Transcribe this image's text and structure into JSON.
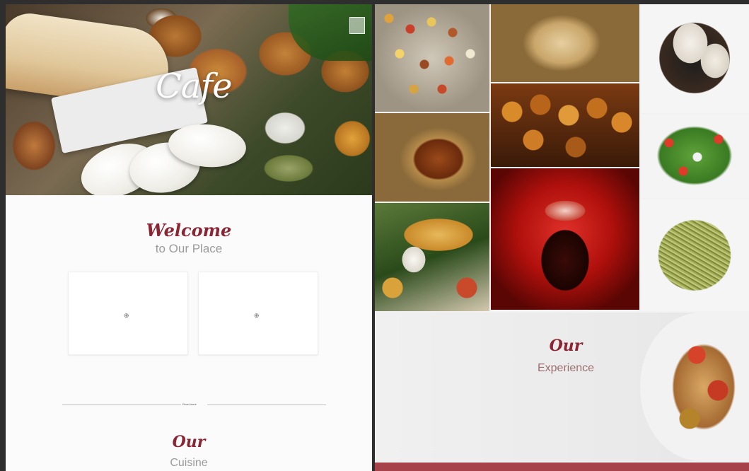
{
  "left_page": {
    "hero": {
      "logo_text": "Cafe",
      "control_icon": "square-icon"
    },
    "welcome": {
      "script": "Welcome",
      "subtitle": "to Our Place"
    },
    "cards": [
      {
        "icon": "image-placeholder-icon",
        "icon_glyph": "⊕"
      },
      {
        "icon": "image-placeholder-icon",
        "icon_glyph": "⊕"
      }
    ],
    "read_more": "Read more",
    "cuisine": {
      "script": "Our",
      "subtitle": "Cuisine"
    }
  },
  "right_page": {
    "gallery_tiles": [
      "spice-platter",
      "paratha-thali",
      "idli-plate",
      "fried-pakora",
      "chicken-bowl",
      "fresh-salad",
      "cola-splash",
      "masala-dosa",
      "green-noodles"
    ],
    "experience": {
      "script": "Our",
      "subtitle": "Experience"
    },
    "footer_color": "#a6424a"
  },
  "colors": {
    "accent_script": "#8c2533",
    "subtitle_gray": "#9b9b9b",
    "background": "#2e2e2e"
  }
}
